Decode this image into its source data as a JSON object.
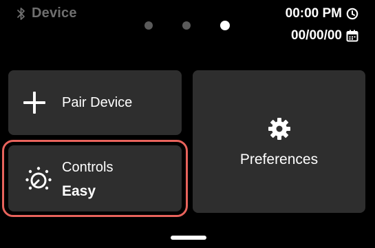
{
  "status_bar": {
    "device_label": "Device",
    "bluetooth_icon": "bluetooth-icon",
    "time": "00:00 PM",
    "time_icon": "clock-icon",
    "date": "00/00/00",
    "date_icon": "calendar-icon"
  },
  "pager": {
    "page_count": 3,
    "active_page": 3
  },
  "tiles": {
    "pair_device": {
      "label": "Pair Device",
      "icon": "plus-icon"
    },
    "controls": {
      "label": "Controls",
      "value": "Easy",
      "icon": "dial-icon",
      "selected": true
    },
    "preferences": {
      "label": "Preferences",
      "icon": "gear-icon"
    }
  },
  "colors": {
    "background": "#000000",
    "tile": "#2e2e2e",
    "highlight": "#e8635c",
    "muted_text": "#6f6f6f",
    "inactive_dot": "#5a5a5a",
    "active_dot": "#ffffff"
  }
}
